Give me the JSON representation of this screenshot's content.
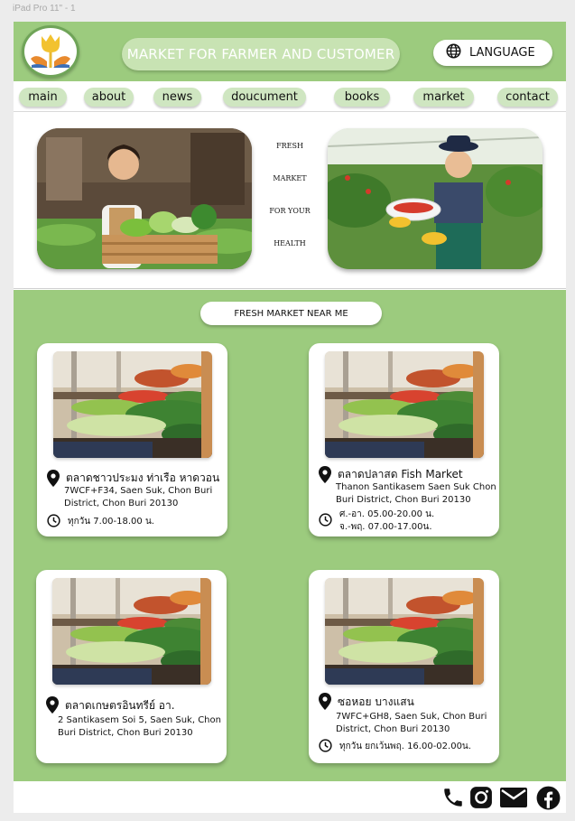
{
  "frame_label": "iPad Pro 11\" - 1",
  "header": {
    "title": "MARKET FOR FARMER AND CUSTOMER",
    "language_label": "LANGUAGE",
    "icons": {
      "logo": "tulip-logo",
      "language": "globe-icon"
    }
  },
  "nav": [
    {
      "label": "main"
    },
    {
      "label": "about"
    },
    {
      "label": "news"
    },
    {
      "label": "doucument"
    },
    {
      "label": "books"
    },
    {
      "label": "market"
    },
    {
      "label": "contact"
    }
  ],
  "hero": {
    "tagline": [
      "FRESH",
      "MARKET",
      "FOR YOUR",
      "HEALTH"
    ],
    "images": [
      "farmer-with-vegetable-crate-photo",
      "farmer-with-strawberry-basket-photo"
    ]
  },
  "markets": {
    "button_label": "FRESH MARKET NEAR ME",
    "cards": [
      {
        "name": "ตลาดชาวประมง ท่าเรือ หาดวอน",
        "address": "7WCF+F34, Saen Suk, Chon Buri District, Chon Buri 20130",
        "hours": [
          "ทุกวัน 7.00-18.00 น."
        ]
      },
      {
        "name": "ตลาดปลาสด Fish Market",
        "address": "Thanon Santikasem Saen Suk Chon Buri District, Chon Buri 20130",
        "hours": [
          "ศ.-อา. 05.00-20.00 น.",
          "จ.-พฤ. 07.00-17.00น."
        ]
      },
      {
        "name": "ตลาดเกษตรอินทรีย์ อา.",
        "address": "2 Santikasem Soi 5, Saen Suk, Chon Buri District, Chon Buri 20130",
        "hours": []
      },
      {
        "name": "ซอหอย บางแสน",
        "address": "7WFC+GH8, Saen Suk, Chon Buri District, Chon Buri 20130",
        "hours": [
          "ทุกวัน ยกเว้นพฤ.  16.00-02.00น."
        ]
      }
    ]
  },
  "footer": {
    "icons": [
      "phone-icon",
      "instagram-icon",
      "mail-icon",
      "facebook-icon"
    ]
  },
  "colors": {
    "green": "#9ccb7e",
    "light_green": "#cfe6c1",
    "title_pill": "#c8e3b3"
  }
}
